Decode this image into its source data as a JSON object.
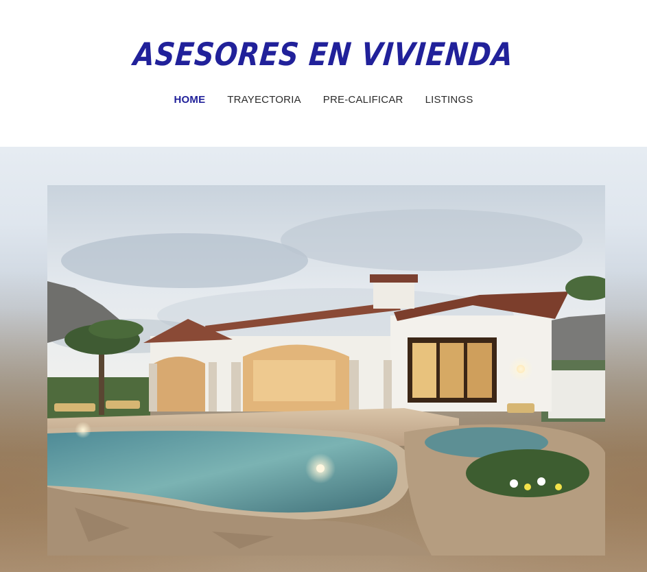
{
  "site": {
    "title": "ASESORES EN VIVIENDA",
    "brand_color": "#21219a"
  },
  "nav": {
    "items": [
      {
        "label": "HOME",
        "active": true
      },
      {
        "label": "TRAYECTORIA",
        "active": false
      },
      {
        "label": "PRE-CALIFICAR",
        "active": false
      },
      {
        "label": "LISTINGS",
        "active": false
      }
    ]
  },
  "hero": {
    "image": "featured-house-photo"
  }
}
